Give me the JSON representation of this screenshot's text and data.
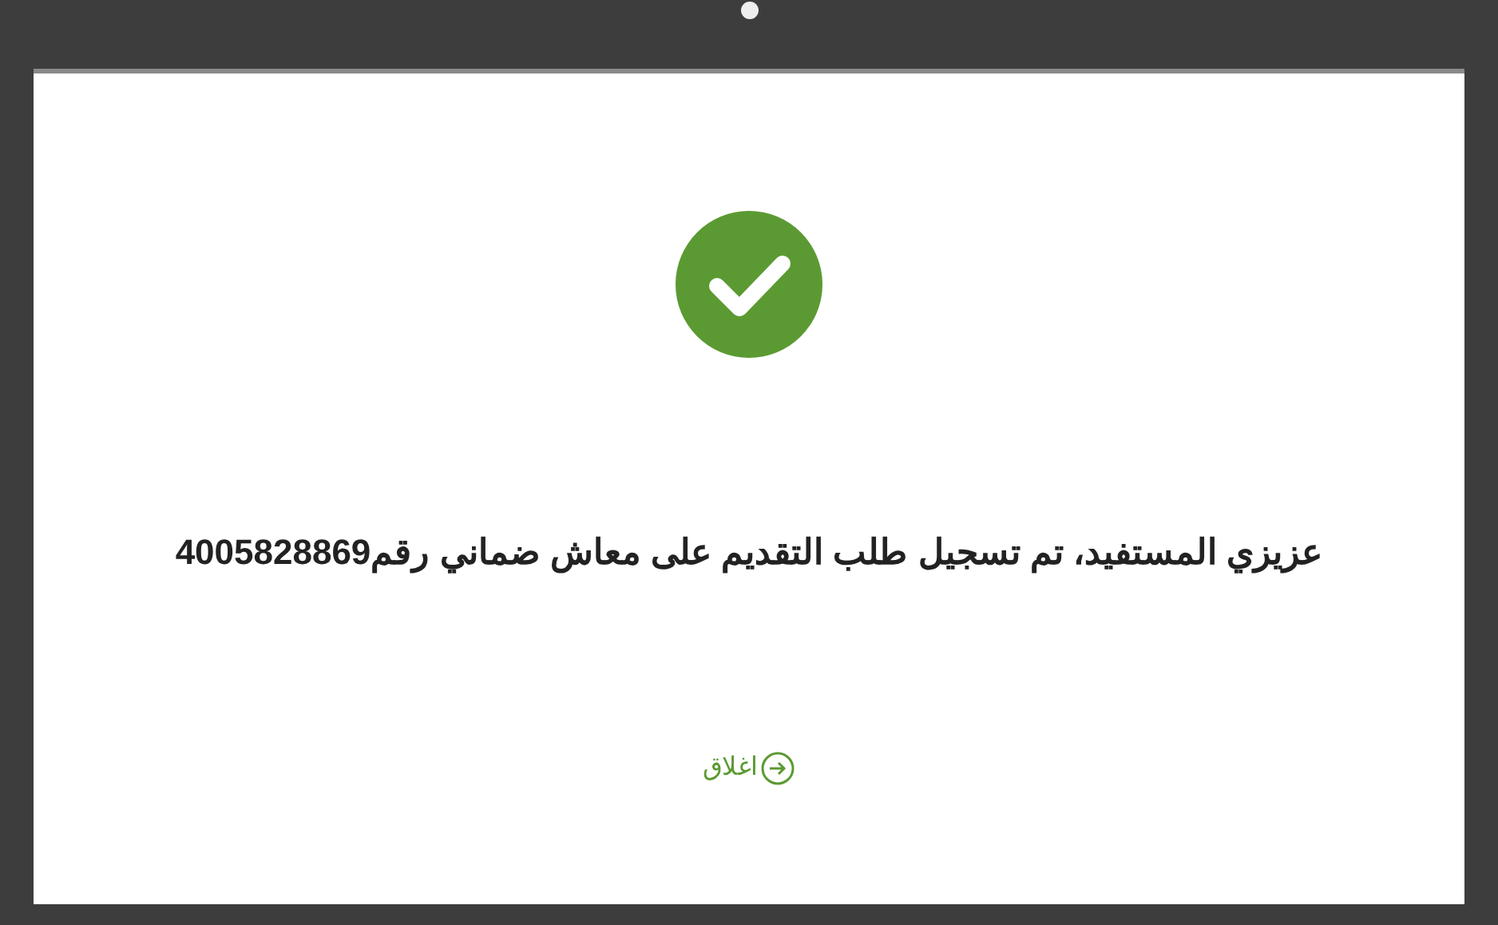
{
  "dialog": {
    "message": "عزيزي المستفيد، تم تسجيل طلب التقديم على معاش ضماني رقم4005828869",
    "close_link": "اغلاق"
  }
}
